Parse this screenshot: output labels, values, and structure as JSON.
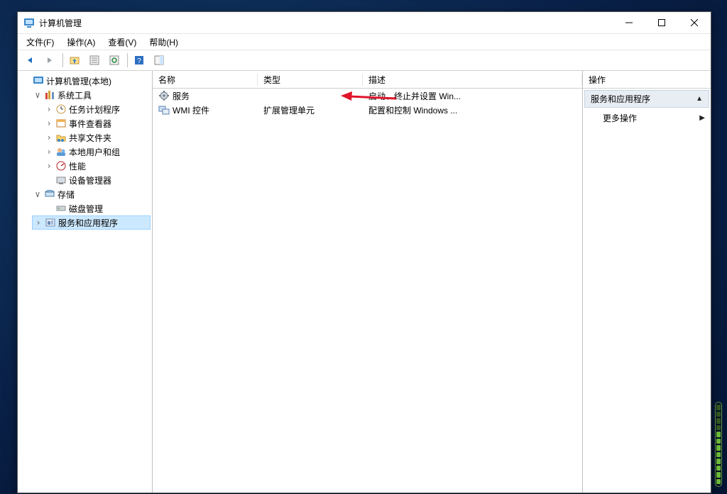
{
  "window": {
    "title": "计算机管理"
  },
  "menus": {
    "file": "文件(F)",
    "action": "操作(A)",
    "view": "查看(V)",
    "help": "帮助(H)"
  },
  "tree": {
    "root": "计算机管理(本地)",
    "system_tools": "系统工具",
    "task_scheduler": "任务计划程序",
    "event_viewer": "事件查看器",
    "shared_folders": "共享文件夹",
    "local_users": "本地用户和组",
    "performance": "性能",
    "device_manager": "设备管理器",
    "storage": "存储",
    "disk_mgmt": "磁盘管理",
    "services_apps": "服务和应用程序"
  },
  "list": {
    "headers": {
      "name": "名称",
      "type": "类型",
      "desc": "描述"
    },
    "rows": [
      {
        "name": "服务",
        "type": "",
        "desc": "启动、终止并设置 Win..."
      },
      {
        "name": "WMI 控件",
        "type": "扩展管理单元",
        "desc": "配置和控制 Windows ..."
      }
    ]
  },
  "actions": {
    "title": "操作",
    "section": "服务和应用程序",
    "more": "更多操作"
  }
}
